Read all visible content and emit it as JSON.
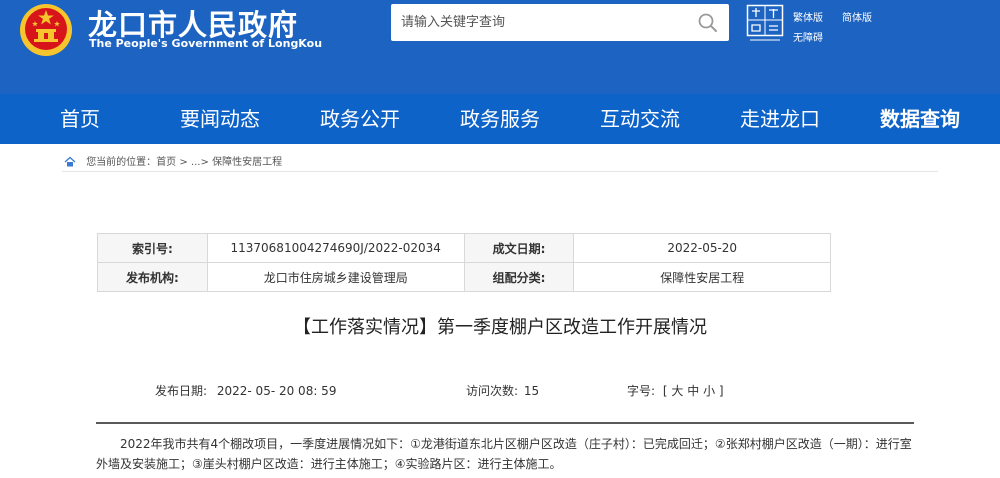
{
  "header": {
    "site_name_cn": "龙口市人民政府",
    "site_name_en": "The People's Government of LongKou",
    "search": {
      "placeholder": "请输入关键字查询"
    },
    "tools": {
      "traditional": "繁体版",
      "simplified": "简体版",
      "accessible": "无障碍"
    }
  },
  "nav": {
    "items": [
      {
        "label": "首页"
      },
      {
        "label": "要闻动态"
      },
      {
        "label": "政务公开"
      },
      {
        "label": "政务服务"
      },
      {
        "label": "互动交流"
      },
      {
        "label": "走进龙口"
      },
      {
        "label": "数据查询"
      }
    ],
    "active_index": 6
  },
  "breadcrumb": {
    "prefix": "您当前的位置：",
    "home": "首页",
    "separator": ">",
    "ellipsis": "...",
    "current": "保障性安居工程"
  },
  "meta": {
    "index_label": "索引号:",
    "index_value": "11370681004274690J/2022-02034",
    "date_label": "成文日期:",
    "date_value": "2022-05-20",
    "publisher_label": "发布机构:",
    "publisher_value": "龙口市住房城乡建设管理局",
    "category_label": "组配分类:",
    "category_value": "保障性安居工程"
  },
  "article": {
    "title": "【工作落实情况】第一季度棚户区改造工作开展情况",
    "publish_label": "发布日期:",
    "publish_value": "2022- 05- 20 08: 59",
    "visits_label": "访问次数:",
    "visits_value": "15",
    "font_label": "字号:",
    "font_open": "[",
    "font_large": "大",
    "font_medium": "中",
    "font_small": "小",
    "font_close": "]",
    "body": "2022年我市共有4个棚改项目，一季度进展情况如下：①龙港街道东北片区棚户区改造（庄子村）：已完成回迁；②张郑村棚户区改造（一期）：进行室外墙及安装施工；③崖头村棚户区改造：进行主体施工；④实验路片区：进行主体施工。"
  },
  "colors": {
    "header_blue": "#1d63c1",
    "nav_blue": "#0e63c8",
    "emblem_red": "#d7141a",
    "emblem_gold": "#f6c42d"
  },
  "icons": {
    "emblem": "national-emblem",
    "search": "search-icon",
    "brand": "longkou-logo",
    "home": "home-icon"
  }
}
